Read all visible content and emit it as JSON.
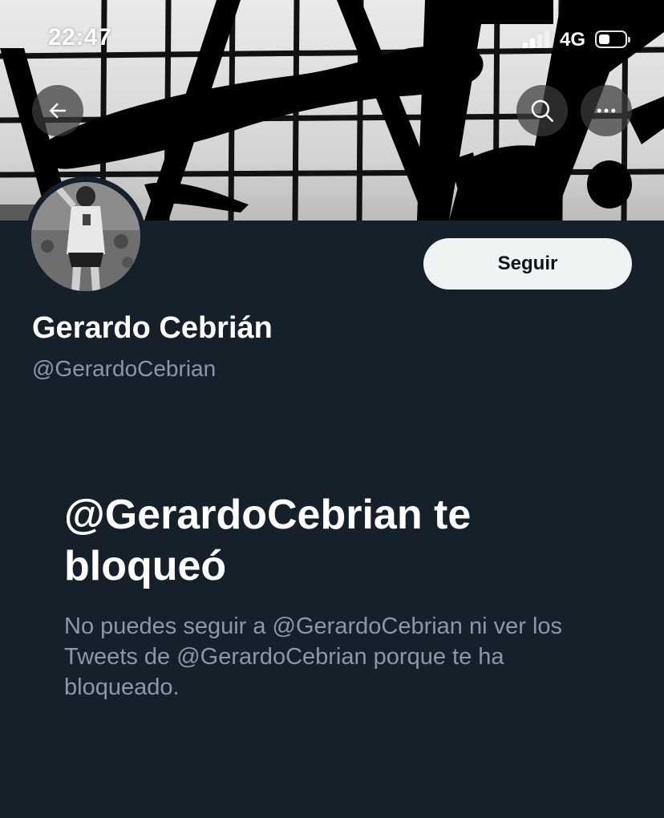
{
  "status_bar": {
    "time": "22:47",
    "network": "4G"
  },
  "header": {
    "back_icon": "arrow-left-icon",
    "search_icon": "search-icon",
    "more_icon": "more-horizontal-icon"
  },
  "profile": {
    "display_name": "Gerardo Cebrián",
    "handle": "@GerardoCebrian",
    "follow_label": "Seguir"
  },
  "blocked": {
    "title": "@GerardoCebrian te bloqueó",
    "description": "No puedes seguir a @GerardoCebrian ni ver los Tweets de @GerardoCebrian porque te ha bloqueado."
  },
  "colors": {
    "background": "#15202b",
    "primary_text": "#ffffff",
    "secondary_text": "#8b98a5",
    "follow_button_bg": "#eff3f4",
    "follow_button_text": "#0f1419"
  }
}
